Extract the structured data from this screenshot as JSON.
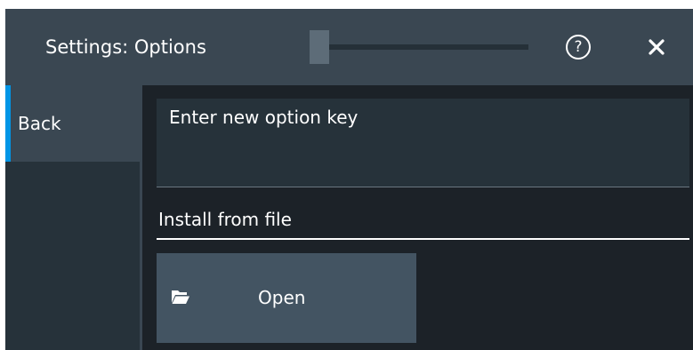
{
  "dialog": {
    "title": "Settings: Options",
    "icons": {
      "help": "help-circle-icon",
      "close": "close-icon",
      "drag_handle": "drag-handle"
    }
  },
  "sidebar": {
    "items": [
      {
        "label": "Back",
        "active": true
      }
    ],
    "accent_color": "#0095e6"
  },
  "main": {
    "option_key": {
      "placeholder": "Enter new option key",
      "value": ""
    },
    "install_section": {
      "label": "Install from file"
    },
    "open_button": {
      "label": "Open",
      "icon": "folder-open-icon"
    }
  },
  "colors": {
    "title_bar": "#3a4752",
    "background": "#1c2228",
    "panel": "#26323a",
    "button": "#435462",
    "text": "#ffffff"
  }
}
